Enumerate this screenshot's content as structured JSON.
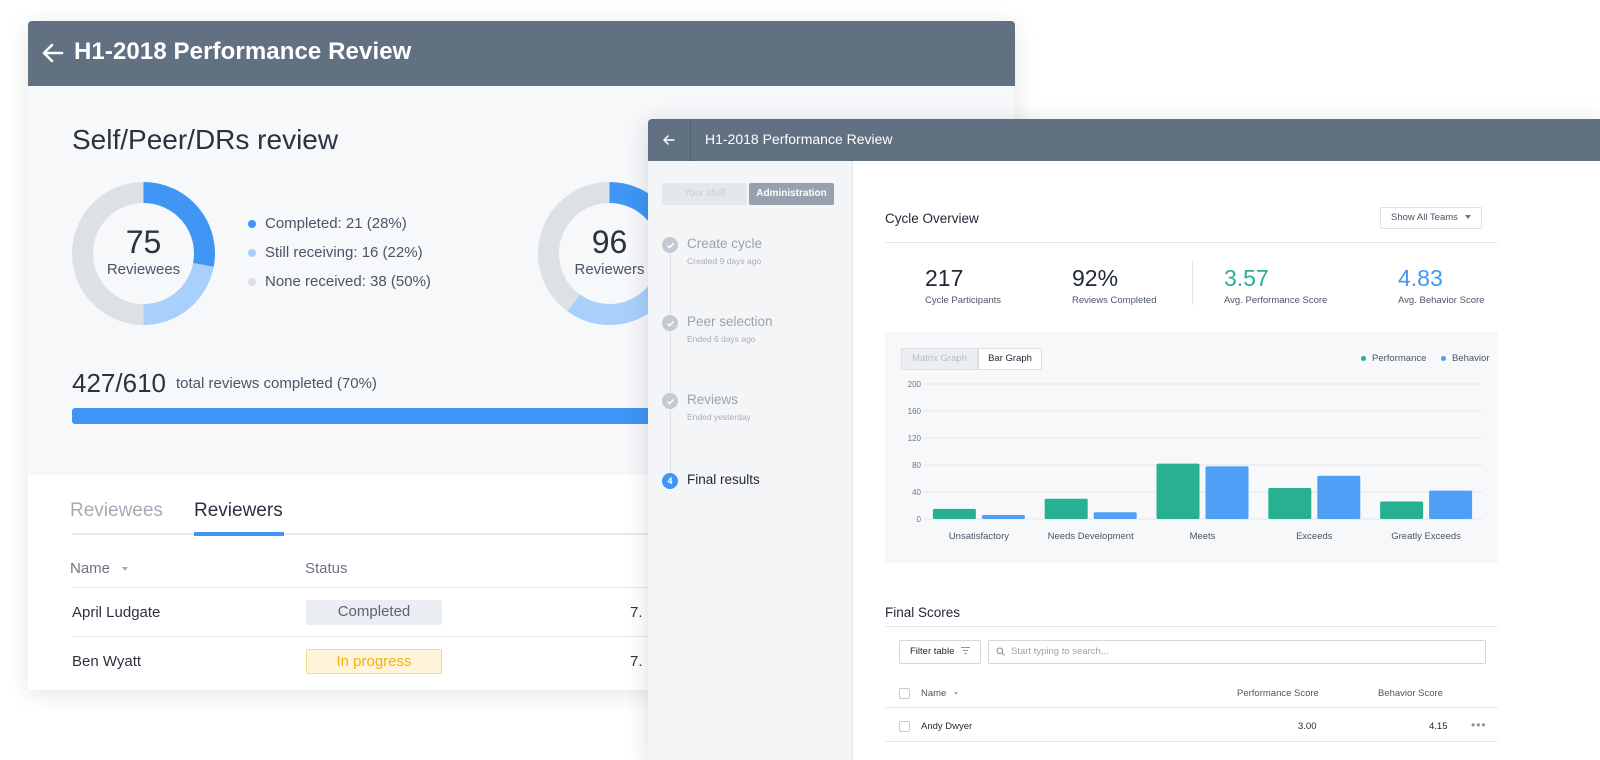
{
  "back_window": {
    "title": "H1-2018 Performance Review",
    "section_title": "Self/Peer/DRs review",
    "donut_reviewees": {
      "count": "75",
      "label": "Reviewees",
      "completed_pct": 28,
      "still_receiving_pct": 22,
      "none_received_pct": 50
    },
    "donut_reviewers": {
      "count": "96",
      "label": "Reviewers"
    },
    "legend": [
      {
        "label": "Completed: 21 (28%)",
        "color": "#3f96f5"
      },
      {
        "label": "Still receiving: 16 (22%)",
        "color": "#a9d0fb"
      },
      {
        "label": "None received: 38 (50%)",
        "color": "#dde1e6"
      }
    ],
    "total_count": "427/610",
    "total_text": "total reviews completed (70%)",
    "total_progress": 0.7,
    "tabs": [
      "Reviewees",
      "Reviewers"
    ],
    "active_tab": "Reviewers",
    "columns": {
      "name": "Name",
      "status": "Status"
    },
    "rows": [
      {
        "name": "April Ludgate",
        "status": "Completed",
        "trail": "7."
      },
      {
        "name": "Ben Wyatt",
        "status": "In progress",
        "trail": "7."
      }
    ]
  },
  "front_window": {
    "title": "H1-2018 Performance Review",
    "segments": {
      "your_stuff": "Your stuff",
      "administration": "Administration"
    },
    "steps": [
      {
        "title": "Create cycle",
        "sub": "Created 9 days ago",
        "done": true
      },
      {
        "title": "Peer selection",
        "sub": "Ended 6 days ago",
        "done": true
      },
      {
        "title": "Reviews",
        "sub": "Ended yesterday",
        "done": true
      },
      {
        "title": "Final results",
        "number": "4",
        "done": false
      }
    ],
    "cycle_overview": {
      "title": "Cycle Overview",
      "team_filter": "Show All Teams",
      "stats": [
        {
          "value": "217",
          "label": "Cycle Participants",
          "color": "#1f2733"
        },
        {
          "value": "92%",
          "label": "Reviews Completed",
          "color": "#1f2733"
        },
        {
          "value": "3.57",
          "label": "Avg. Performance Score",
          "color": "#27b192"
        },
        {
          "value": "4.83",
          "label": "Avg. Behavior Score",
          "color": "#3f96f5"
        }
      ]
    },
    "graph_tabs": {
      "matrix": "Matrix Graph",
      "bar": "Bar Graph"
    },
    "final_scores": {
      "title": "Final Scores",
      "filter_label": "Filter table",
      "search_placeholder": "Start typing to search...",
      "columns": {
        "name": "Name",
        "performance": "Performance Score",
        "behavior": "Behavior Score"
      },
      "rows": [
        {
          "name": "Andy Dwyer",
          "performance": "3.00",
          "behavior": "4.15"
        }
      ]
    }
  },
  "chart_data": {
    "type": "bar",
    "categories": [
      "Unsatisfactory",
      "Needs Development",
      "Meets",
      "Exceeds",
      "Greatly Exceeds"
    ],
    "series": [
      {
        "name": "Performance",
        "color": "#27b192",
        "values": [
          15,
          30,
          82,
          46,
          26
        ]
      },
      {
        "name": "Behavior",
        "color": "#4e9ff5",
        "values": [
          6,
          10,
          78,
          64,
          42
        ]
      }
    ],
    "yticks": [
      0,
      40,
      80,
      120,
      160,
      200
    ],
    "ylim": [
      0,
      200
    ],
    "legend_position": "top-right",
    "grid": true
  }
}
